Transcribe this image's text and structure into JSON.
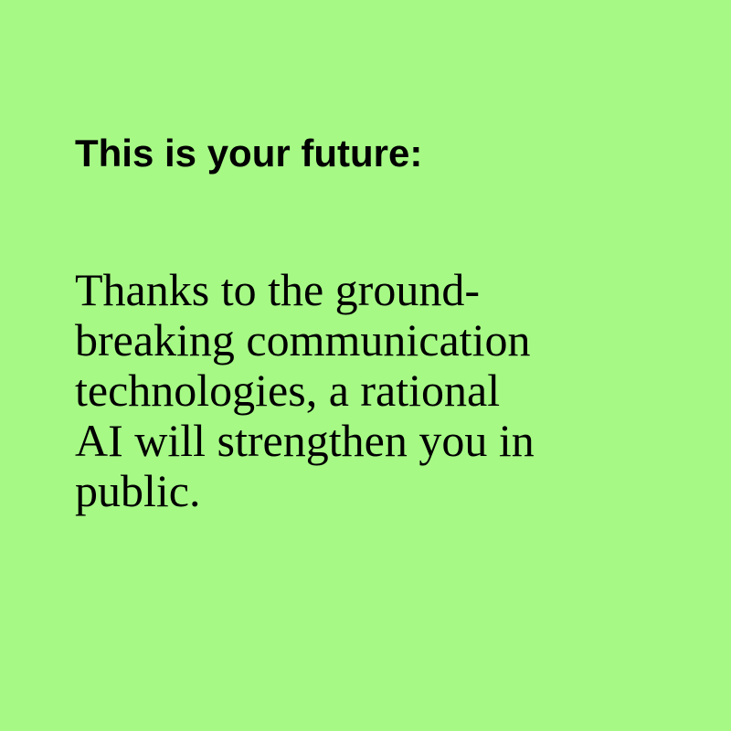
{
  "colors": {
    "background": "#a6f985",
    "text": "#000000"
  },
  "heading": "This is your future:",
  "body_lines": [
    "Thanks to the ground-",
    "breaking communication",
    "technologies, a rational",
    "AI will strengthen you in",
    "public."
  ]
}
